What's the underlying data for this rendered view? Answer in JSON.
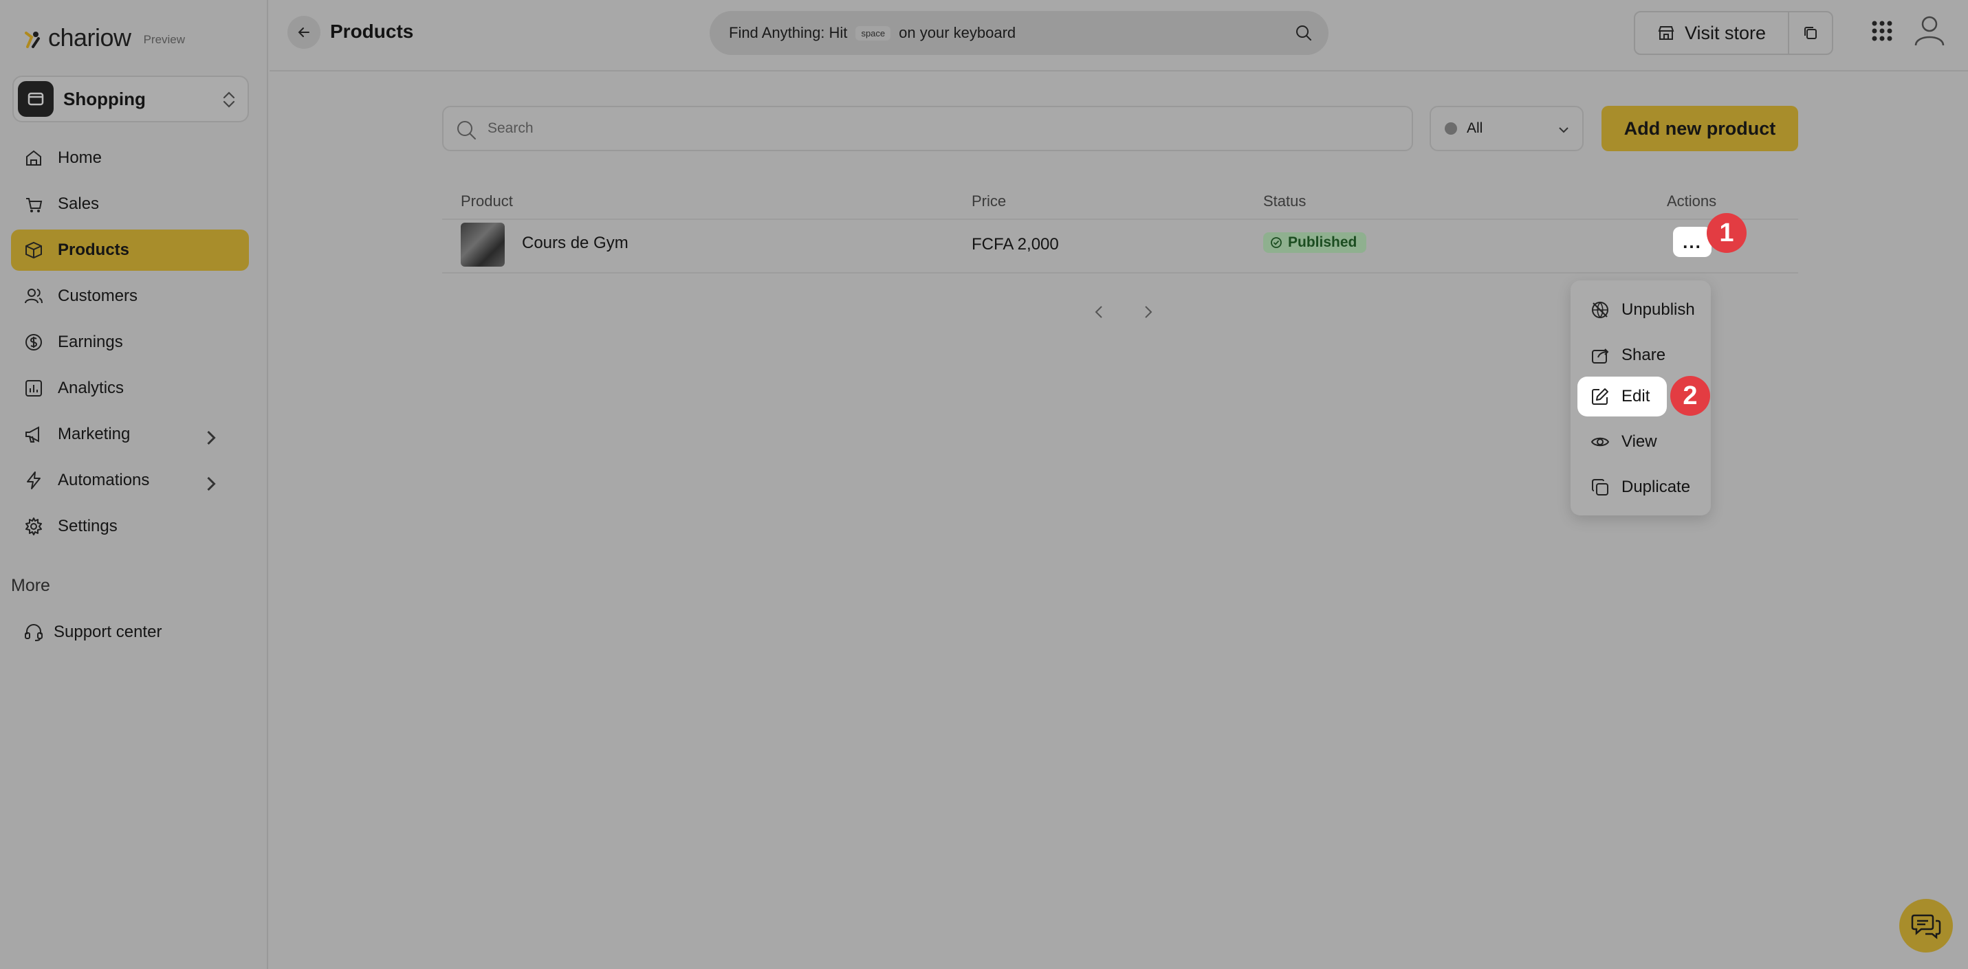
{
  "brand": {
    "name": "chariow",
    "tag": "Preview"
  },
  "store": {
    "name": "Shopping"
  },
  "nav": {
    "items": [
      {
        "label": "Home"
      },
      {
        "label": "Sales"
      },
      {
        "label": "Products"
      },
      {
        "label": "Customers"
      },
      {
        "label": "Earnings"
      },
      {
        "label": "Analytics"
      },
      {
        "label": "Marketing"
      },
      {
        "label": "Automations"
      },
      {
        "label": "Settings"
      }
    ],
    "more_label": "More",
    "support_label": "Support center"
  },
  "topbar": {
    "title": "Products",
    "find_prefix": "Find Anything: Hit",
    "find_key": "space",
    "find_suffix": "on your keyboard",
    "visit_store": "Visit store"
  },
  "toolbar": {
    "search_placeholder": "Search",
    "status_filter": "All",
    "add_button": "Add new product"
  },
  "table": {
    "columns": [
      "Product",
      "Price",
      "Status",
      "Actions"
    ],
    "rows": [
      {
        "name": "Cours de Gym",
        "price": "FCFA 2,000",
        "status": "Published",
        "actions": "..."
      }
    ]
  },
  "menu": {
    "items": [
      {
        "label": "Unpublish"
      },
      {
        "label": "Share"
      },
      {
        "label": "Edit"
      },
      {
        "label": "View"
      },
      {
        "label": "Duplicate"
      }
    ]
  },
  "markers": [
    "1",
    "2"
  ],
  "colors": {
    "accent": "#a88d2b",
    "marker": "#e33c42",
    "published": "#1c4d21"
  }
}
